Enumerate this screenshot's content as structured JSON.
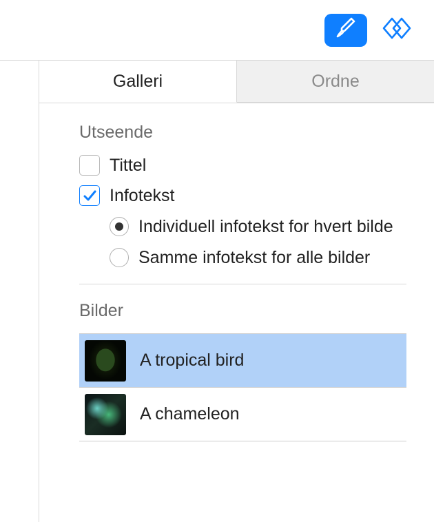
{
  "toolbar": {
    "format_icon": "format-paintbrush-icon",
    "shapes_icon": "shapes-diamond-icon"
  },
  "tabs": {
    "gallery": "Galleri",
    "arrange": "Ordne"
  },
  "appearance": {
    "title": "Utseende",
    "title_checkbox": "Tittel",
    "caption_checkbox": "Infotekst",
    "radio_individual": "Individuell infotekst for hvert bilde",
    "radio_same": "Samme infotekst for alle bilder"
  },
  "images": {
    "title": "Bilder",
    "items": [
      {
        "label": "A tropical bird",
        "selected": true
      },
      {
        "label": "A chameleon",
        "selected": false
      }
    ]
  }
}
